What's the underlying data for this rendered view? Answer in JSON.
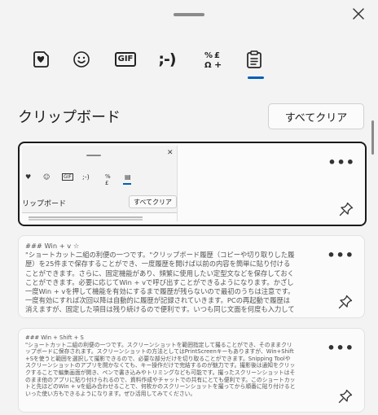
{
  "window": {
    "close_icon": "close-icon"
  },
  "tabs": [
    {
      "id": "stickers",
      "icon": "heart-stickers-icon"
    },
    {
      "id": "emoji",
      "icon": "smiley-icon",
      "glyph": "☺"
    },
    {
      "id": "gif",
      "icon": "gif-icon",
      "label": "GIF"
    },
    {
      "id": "kaomoji",
      "icon": "kaomoji-icon",
      "label": ";-)"
    },
    {
      "id": "symbols",
      "icon": "symbols-icon",
      "label": "% £\nΩ+"
    },
    {
      "id": "clipboard",
      "icon": "clipboard-icon",
      "active": true
    }
  ],
  "clipboard": {
    "title": "クリップボード",
    "clear_all": "すべてクリア",
    "accent_color": "#005fb8"
  },
  "items": [
    {
      "type": "image",
      "thumbnail": {
        "title": "リップボード",
        "clear_all": "すべてクリア"
      }
    },
    {
      "type": "text",
      "text": "### Win + v ☆\n\"ショートカット二組の利便の一つです。\"クリップボード履歴（コピーや切り取りした履歴）を25件まで保存することができ、一度履歴を開けば以前の内容を簡単に貼り付けることができます。さらに、固定機能があり、頻繁に使用したい定型文などを保存しておくことができます。必要に応じてWin + vで呼び出すことができるようになります。かざし一度Win + vを押して機能を有効にするまで履歴が残らないので最初のうちは注意です。一度有効にすれば次回以降は自動的に履歴が記録されていきます。PCの再起動で履歴は消えますが、固定した項目は残り続けるので便利です。いつも同じ文面を何度も入力している方にはおすすめの機能です。これを使えば効率が大きく上がると思います。Excelでそれか"
    },
    {
      "type": "text",
      "text": "### Win + Shift + S\n\"ショートカット二組の利便の一つです。スクリーンショットを範囲指定して撮ることができ、そのままクリップボードに保存されます。スクリーンショットの方法としてはPrintScreenキーもありますが、Win+Shift+Sを使うと範囲を選択して撮影できるので、必要な部分だけを切り取ることができます。Snipping Toolやスクリーンショットのアプリを開かなくても、キー操作だけで完結するのが魅力です。撮影後は通知をクリックすることで編集画面が開き、ペンで書き込みやトリミングなども可能です。撮ったスクリーンショットはそのまま他のアプリに貼り付けられるので、資料作成やチャットでの共有にとても便利です。このショートカットと先ほどのWin + vを組み合わせることで、何枚かのスクリーンショットを撮ってから順番に貼り付けるといった使い方もできるようになります。ぜひ活用してみてください。"
    }
  ]
}
